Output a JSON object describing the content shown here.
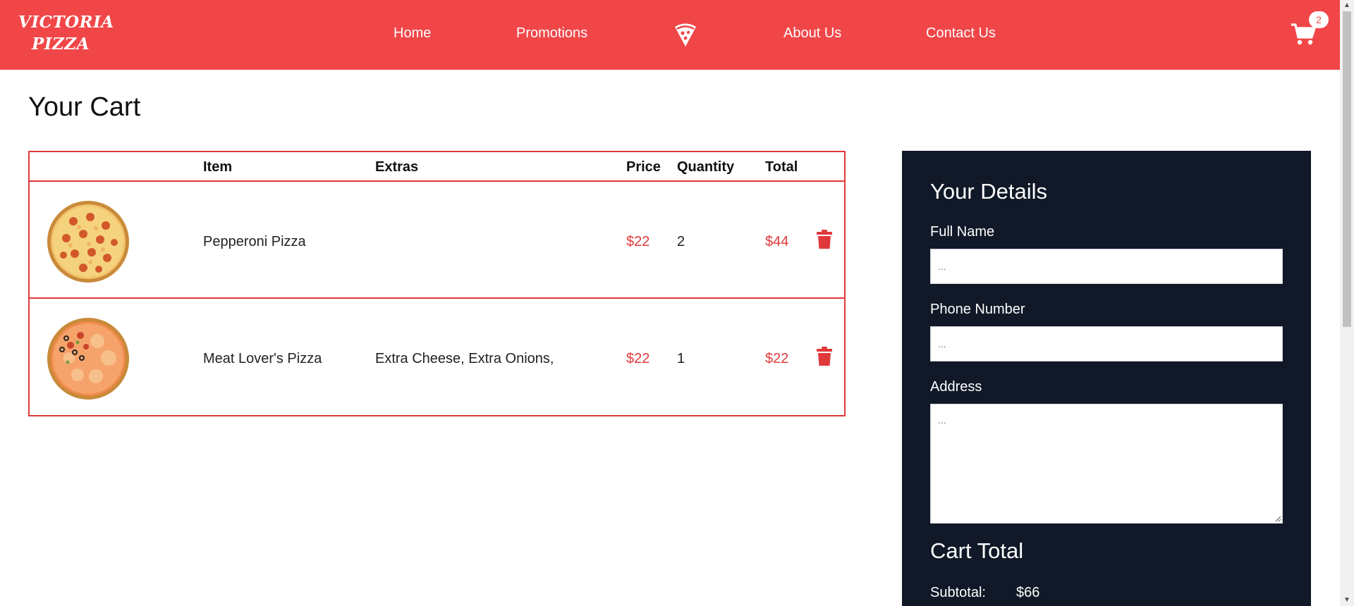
{
  "brand": {
    "line1": "VICTORIA",
    "line2": "PIZZA"
  },
  "nav": {
    "home": "Home",
    "promotions": "Promotions",
    "center_icon": "pizza-slice-icon",
    "about": "About Us",
    "contact": "Contact Us"
  },
  "cart": {
    "icon": "shopping-cart-icon",
    "count": "2"
  },
  "page": {
    "title": "Your Cart"
  },
  "table": {
    "headers": {
      "item": "Item",
      "extras": "Extras",
      "price": "Price",
      "quantity": "Quantity",
      "total": "Total"
    },
    "rows": [
      {
        "item": "Pepperoni Pizza",
        "extras": "",
        "price": "$22",
        "quantity": "2",
        "total": "$44",
        "image": "pepperoni-pizza"
      },
      {
        "item": "Meat Lover's Pizza",
        "extras": "Extra Cheese, Extra Onions,",
        "price": "$22",
        "quantity": "1",
        "total": "$22",
        "image": "meat-lovers-pizza"
      }
    ]
  },
  "details": {
    "title": "Your Details",
    "full_name_label": "Full Name",
    "full_name_placeholder": "...",
    "phone_label": "Phone Number",
    "phone_placeholder": "...",
    "address_label": "Address",
    "address_placeholder": "...",
    "cart_total_title": "Cart Total",
    "subtotal_label": "Subtotal:",
    "subtotal_value": "$66"
  },
  "colors": {
    "brand_red": "#f14648",
    "accent_red": "#e0393b",
    "panel_dark": "#111827"
  }
}
